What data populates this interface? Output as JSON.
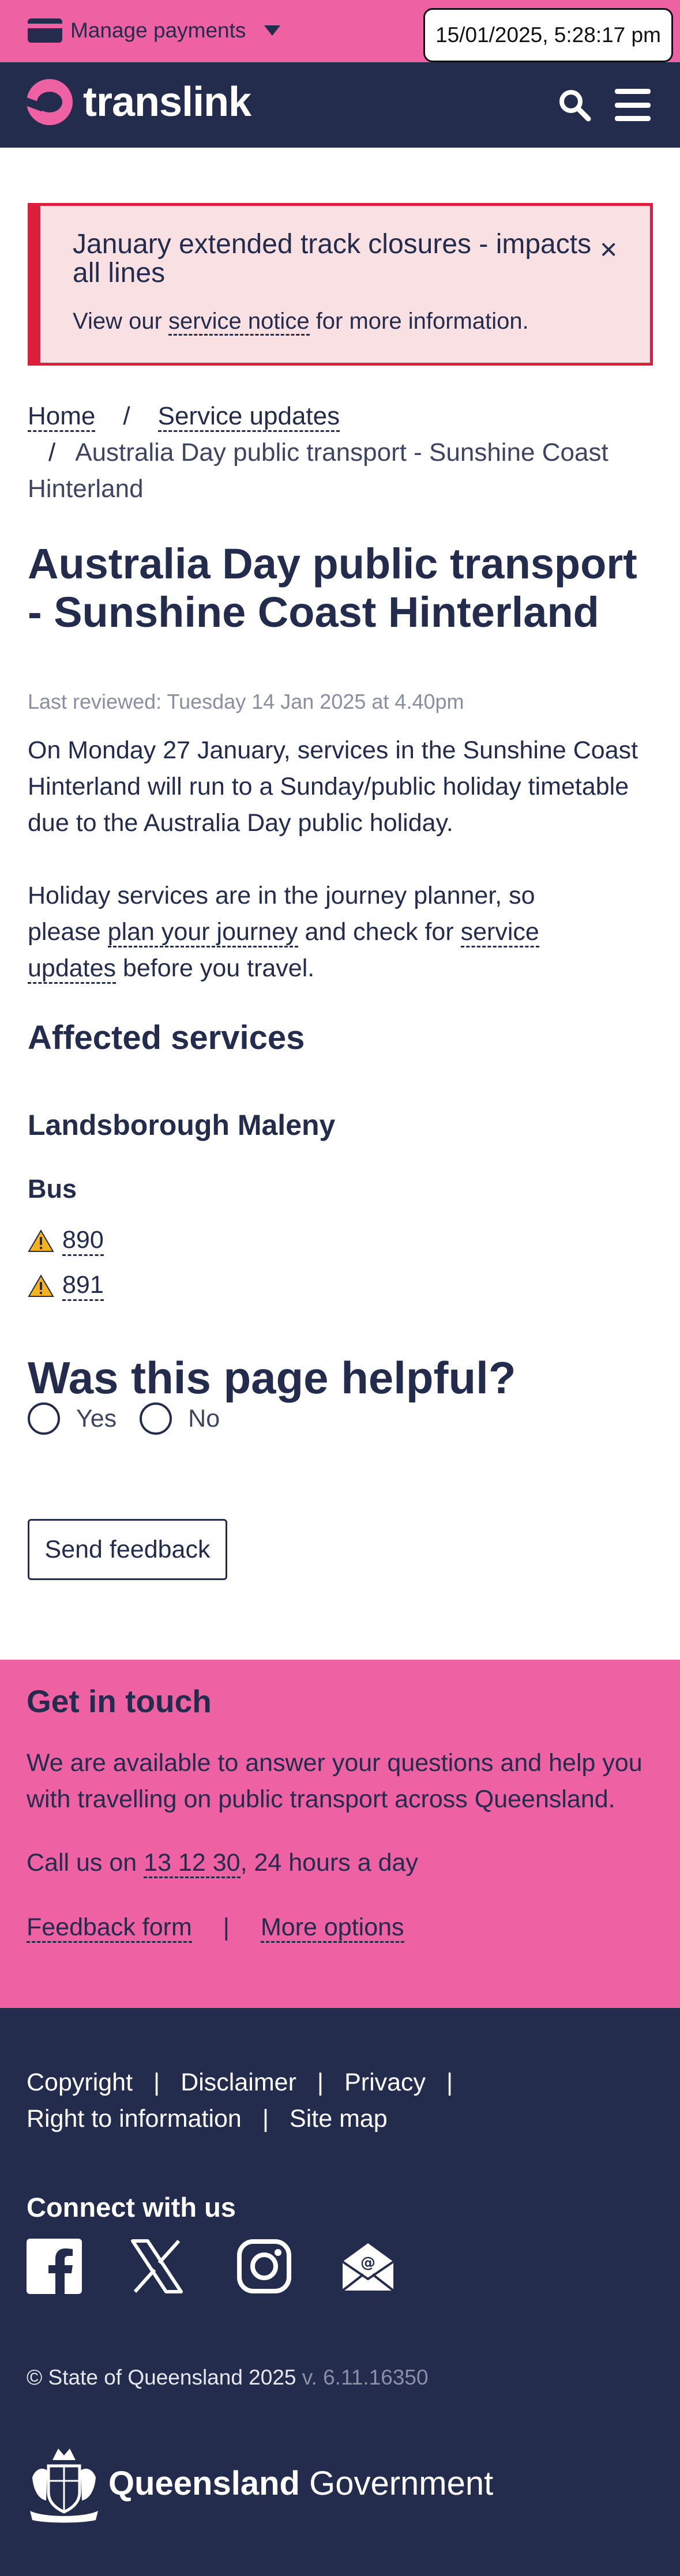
{
  "topbar": {
    "manage_label": "Manage payments",
    "datetime": "15/01/2025, 5:28:17 pm"
  },
  "header": {
    "brand": "translink"
  },
  "alert": {
    "title": "January extended track closures - impacts all lines",
    "body_before": "View our ",
    "body_link": "service notice",
    "body_after": " for more information.",
    "close_glyph": "×"
  },
  "breadcrumb": {
    "home": "Home",
    "separator": "/",
    "service_updates": "Service updates",
    "current": "Australia Day public transport - Sunshine Coast Hinterland"
  },
  "page": {
    "title": "Australia Day public transport - Sunshine Coast Hinterland",
    "last_reviewed": "Last reviewed: Tuesday 14 Jan 2025 at 4.40pm",
    "para1": "On Monday 27 January, services in the Sunshine Coast Hinterland will run to a Sunday/public holiday timetable due to the Australia Day public holiday.",
    "para2_a": "Holiday services are in the journey planner, so please ",
    "para2_link1": "plan your journey",
    "para2_b": " and check for ",
    "para2_link2": "service updates",
    "para2_c": " before you travel."
  },
  "affected": {
    "heading": "Affected services",
    "route": "Landsborough Maleny",
    "mode": "Bus",
    "services": [
      "890",
      "891"
    ]
  },
  "feedback": {
    "question": "Was this page helpful?",
    "yes": "Yes",
    "no": "No",
    "send": "Send feedback"
  },
  "contact": {
    "heading": "Get in touch",
    "description": "We are available to answer your questions and help you with travelling on public transport across Queensland.",
    "call_before": "Call us on ",
    "phone": "13 12 30",
    "call_after": ", 24 hours a day",
    "feedback_form": "Feedback form",
    "separator": "|",
    "more_options": "More options"
  },
  "footer": {
    "links": [
      "Copyright",
      "Disclaimer",
      "Privacy",
      "Right to information",
      "Site map"
    ],
    "separator": "|",
    "connect": "Connect with us",
    "social_icons": [
      "facebook-icon",
      "x-icon",
      "instagram-icon",
      "email-icon"
    ],
    "copyright": "© State of Queensland 2025",
    "version": "v. 6.11.16350",
    "govt_bold": "Queensland",
    "govt_light": "Government"
  },
  "colors": {
    "navy": "#232c4c",
    "pink": "#ee61a3",
    "alert_red": "#dd1e3c",
    "alert_bg": "#f9e1e3",
    "warning_yellow": "#f6b21c"
  }
}
